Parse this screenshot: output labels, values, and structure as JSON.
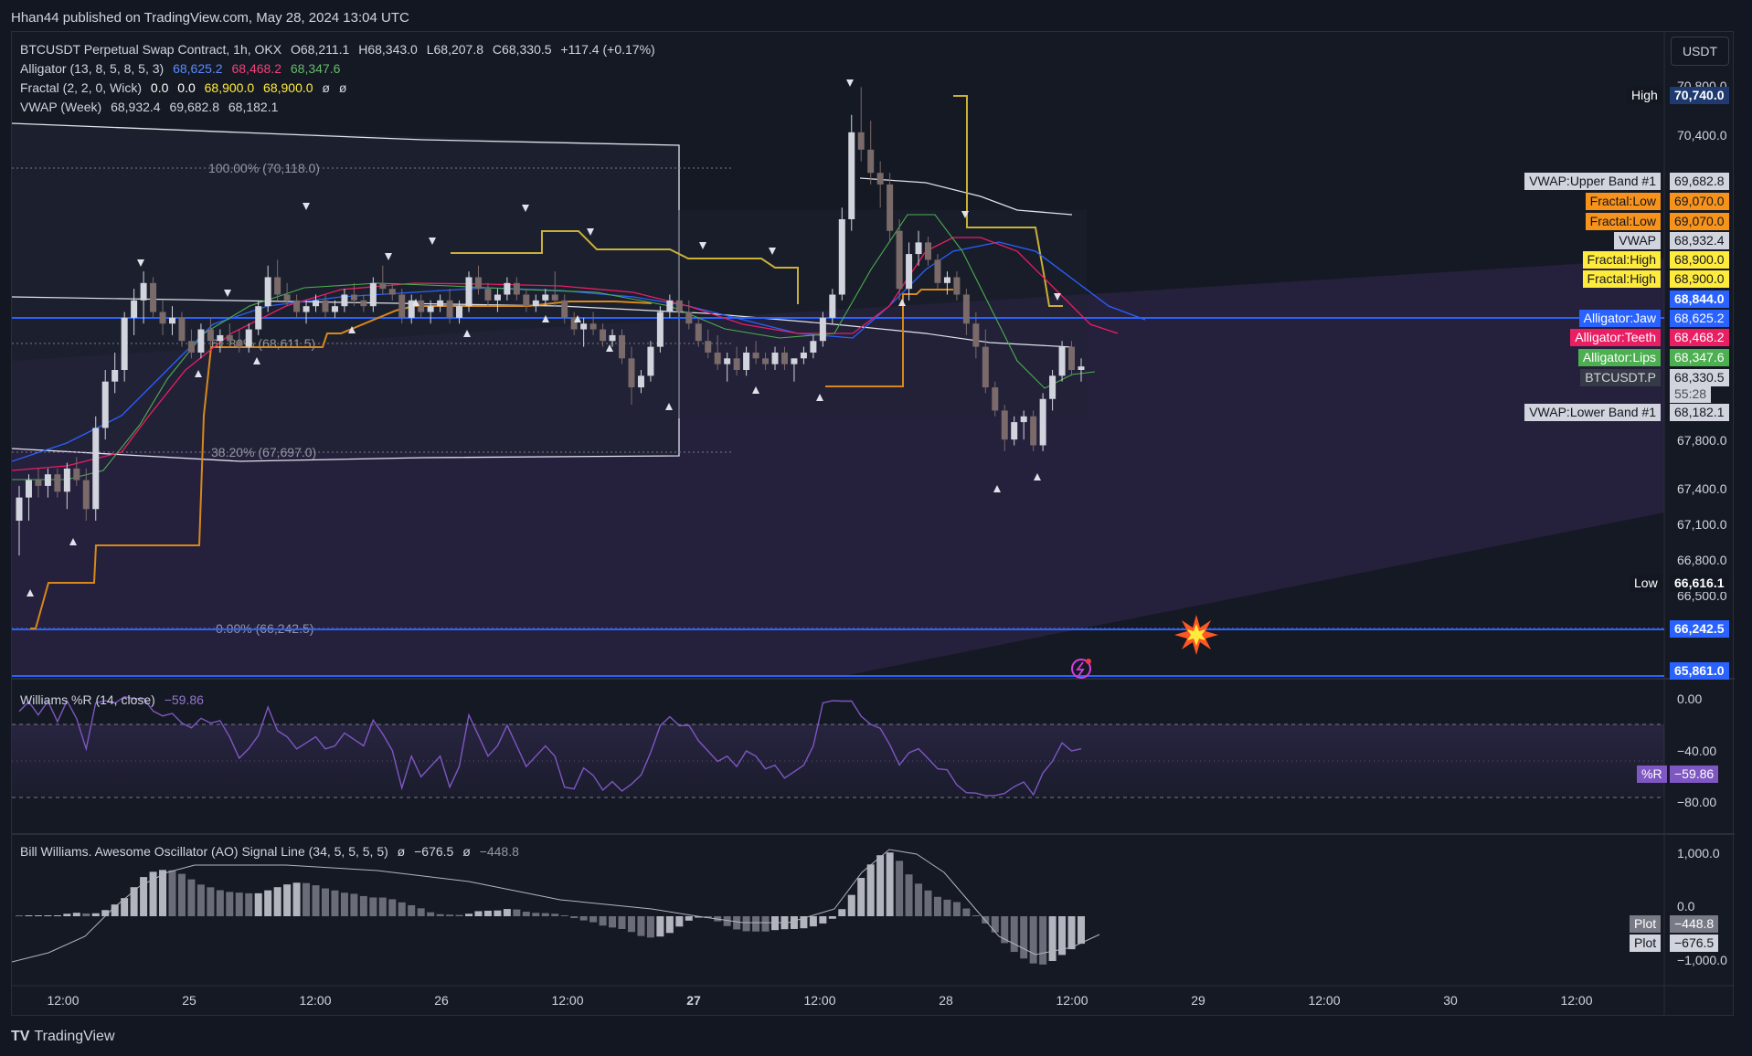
{
  "header": {
    "publisher": "Hhan44 published on TradingView.com, May 28, 2024 13:04 UTC"
  },
  "currency_button": "USDT",
  "footer": {
    "brand": "TradingView"
  },
  "legend": {
    "symbol": {
      "label": "BTCUSDT Perpetual Swap Contract, 1h, OKX",
      "o": "O68,211.1",
      "h": "H68,343.0",
      "l": "L68,207.8",
      "c": "C68,330.5",
      "chg": "+117.4 (+0.17%)"
    },
    "alligator": {
      "label": "Alligator (13, 8, 5, 8, 5, 3)",
      "jaw": "68,625.2",
      "teeth": "68,468.2",
      "lips": "68,347.6"
    },
    "fractal": {
      "label": "Fractal (2, 2, 0, Wick)",
      "v1": "0.0",
      "v2": "0.0",
      "v3": "68,900.0",
      "v4": "68,900.0",
      "v5": "ø",
      "v6": "ø"
    },
    "vwap": {
      "label": "VWAP (Week)",
      "v1": "68,932.4",
      "v2": "69,682.8",
      "v3": "68,182.1"
    },
    "williams": {
      "label": "Williams %R (14, close)",
      "value": "−59.86"
    },
    "ao": {
      "label": "Bill Williams. Awesome Oscillator (AO) Signal Line (34, 5, 5, 5, 5)",
      "v1": "ø",
      "v2": "−676.5",
      "v3": "ø",
      "v4": "−448.8"
    }
  },
  "price_axis": {
    "ticks": [
      "70,800.0",
      "70,400.0",
      "67,800.0",
      "67,400.0",
      "67,100.0",
      "66,800.0",
      "66,500.0"
    ],
    "high": {
      "label": "High",
      "value": "70,740.0"
    },
    "low": {
      "label": "Low",
      "value": "66,616.1"
    },
    "tags": [
      {
        "label": "VWAP:Upper Band #1",
        "value": "69,682.8",
        "color": "#e0e3eb"
      },
      {
        "label": "Fractal:Low",
        "value": "69,070.0",
        "color": "#f7931a"
      },
      {
        "label": "Fractal:Low",
        "value": "69,070.0",
        "color": "#f7931a"
      },
      {
        "label": "VWAP",
        "value": "68,932.4",
        "color": "#e0e3eb"
      },
      {
        "label": "Fractal:High",
        "value": "68,900.0",
        "color": "#ffeb3b"
      },
      {
        "label": "Fractal:High",
        "value": "68,900.0",
        "color": "#ffeb3b"
      },
      {
        "label": "",
        "value": "68,844.0",
        "color": "#2962ff"
      },
      {
        "label": "Alligator:Jaw",
        "value": "68,625.2",
        "color": "#2962ff"
      },
      {
        "label": "Alligator:Teeth",
        "value": "68,468.2",
        "color": "#e91e63"
      },
      {
        "label": "Alligator:Lips",
        "value": "68,347.6",
        "color": "#4caf50"
      },
      {
        "label": "BTCUSDT.P",
        "value": "68,330.5",
        "color": "#d1d4dc"
      },
      {
        "label": "VWAP:Lower Band #1",
        "value": "68,182.1",
        "color": "#e0e3eb"
      },
      {
        "label": "",
        "value": "66,242.5",
        "color": "#2962ff"
      },
      {
        "label": "",
        "value": "65,861.0",
        "color": "#2962ff"
      }
    ],
    "countdown": "55:28"
  },
  "fib_labels": [
    "100.00% (70,118.0)",
    "61.80% (68,611.5)",
    "38.20% (67,697.0)",
    "0.00% (66,242.5)"
  ],
  "wr_axis": {
    "ticks": [
      "0.00",
      "−40.00",
      "−80.00"
    ],
    "tag_label": "%R",
    "tag_value": "−59.86"
  },
  "ao_axis": {
    "ticks": [
      "1,000.0",
      "0.0",
      "−1,000.0"
    ],
    "plot1": {
      "label": "Plot",
      "value": "−448.8"
    },
    "plot2": {
      "label": "Plot",
      "value": "−676.5"
    }
  },
  "time_axis": [
    "12:00",
    "25",
    "12:00",
    "26",
    "12:00",
    "27",
    "12:00",
    "28",
    "12:00",
    "29",
    "12:00",
    "30",
    "12:00"
  ],
  "chart_data": {
    "type": "candlestick",
    "symbol": "BTCUSDT.P",
    "timeframe": "1h",
    "price_range": [
      65700,
      70900
    ],
    "candles": [
      [
        67000,
        67300,
        66700,
        67200
      ],
      [
        67200,
        67400,
        67000,
        67350
      ],
      [
        67350,
        67450,
        67200,
        67300
      ],
      [
        67300,
        67450,
        67200,
        67400
      ],
      [
        67400,
        67450,
        67200,
        67250
      ],
      [
        67250,
        67500,
        67100,
        67450
      ],
      [
        67450,
        67550,
        67300,
        67350
      ],
      [
        67350,
        67450,
        67000,
        67100
      ],
      [
        67100,
        67900,
        67000,
        67800
      ],
      [
        67800,
        68300,
        67700,
        68200
      ],
      [
        68200,
        68450,
        68100,
        68300
      ],
      [
        68300,
        68800,
        68200,
        68750
      ],
      [
        68750,
        69000,
        68600,
        68900
      ],
      [
        68900,
        69150,
        68700,
        69050
      ],
      [
        69050,
        69100,
        68750,
        68800
      ],
      [
        68800,
        68900,
        68600,
        68700
      ],
      [
        68700,
        68850,
        68600,
        68750
      ],
      [
        68750,
        68800,
        68500,
        68550
      ],
      [
        68550,
        68650,
        68400,
        68450
      ],
      [
        68450,
        68700,
        68400,
        68650
      ],
      [
        68650,
        68750,
        68500,
        68550
      ],
      [
        68550,
        68650,
        68450,
        68600
      ],
      [
        68600,
        68700,
        68500,
        68550
      ],
      [
        68550,
        68650,
        68450,
        68500
      ],
      [
        68500,
        68700,
        68450,
        68650
      ],
      [
        68650,
        68900,
        68600,
        68850
      ],
      [
        68850,
        69200,
        68800,
        69100
      ],
      [
        69100,
        69250,
        68900,
        68950
      ],
      [
        68950,
        69050,
        68850,
        68900
      ],
      [
        68900,
        68950,
        68750,
        68800
      ],
      [
        68800,
        68900,
        68700,
        68850
      ],
      [
        68850,
        68950,
        68800,
        68900
      ],
      [
        68900,
        68950,
        68750,
        68800
      ],
      [
        68800,
        68900,
        68750,
        68850
      ],
      [
        68850,
        69000,
        68800,
        68950
      ],
      [
        68950,
        69050,
        68850,
        68900
      ],
      [
        68900,
        68950,
        68800,
        68850
      ],
      [
        68850,
        69100,
        68800,
        69050
      ],
      [
        69050,
        69200,
        68950,
        69000
      ],
      [
        69000,
        69050,
        68900,
        68950
      ],
      [
        68950,
        69000,
        68700,
        68750
      ],
      [
        68750,
        68950,
        68700,
        68900
      ],
      [
        68900,
        68950,
        68750,
        68800
      ],
      [
        68800,
        68900,
        68700,
        68850
      ],
      [
        68850,
        68950,
        68800,
        68900
      ],
      [
        68900,
        69000,
        68700,
        68750
      ],
      [
        68750,
        68900,
        68700,
        68850
      ],
      [
        68850,
        69150,
        68800,
        69100
      ],
      [
        69100,
        69200,
        68950,
        69000
      ],
      [
        69000,
        69050,
        68850,
        68900
      ],
      [
        68900,
        69000,
        68800,
        68950
      ],
      [
        68950,
        69100,
        68900,
        69050
      ],
      [
        69050,
        69100,
        68900,
        68950
      ],
      [
        68950,
        69000,
        68800,
        68850
      ],
      [
        68850,
        68950,
        68800,
        68900
      ],
      [
        68900,
        69000,
        68850,
        68950
      ],
      [
        68950,
        69150,
        68850,
        68900
      ],
      [
        68900,
        68950,
        68700,
        68750
      ],
      [
        68750,
        68800,
        68600,
        68650
      ],
      [
        68650,
        68750,
        68500,
        68700
      ],
      [
        68700,
        68800,
        68600,
        68650
      ],
      [
        68650,
        68700,
        68500,
        68550
      ],
      [
        68550,
        68650,
        68500,
        68600
      ],
      [
        68600,
        68650,
        68350,
        68400
      ],
      [
        68400,
        68500,
        68000,
        68150
      ],
      [
        68150,
        68300,
        68100,
        68250
      ],
      [
        68250,
        68550,
        68200,
        68500
      ],
      [
        68500,
        68850,
        68450,
        68800
      ],
      [
        68800,
        68950,
        68750,
        68900
      ],
      [
        68900,
        69000,
        68750,
        68800
      ],
      [
        68800,
        68900,
        68650,
        68700
      ],
      [
        68700,
        68750,
        68500,
        68550
      ],
      [
        68550,
        68650,
        68400,
        68450
      ],
      [
        68450,
        68600,
        68300,
        68350
      ],
      [
        68350,
        68450,
        68200,
        68400
      ],
      [
        68400,
        68500,
        68250,
        68300
      ],
      [
        68300,
        68500,
        68250,
        68450
      ],
      [
        68450,
        68550,
        68350,
        68400
      ],
      [
        68400,
        68450,
        68300,
        68350
      ],
      [
        68350,
        68500,
        68300,
        68450
      ],
      [
        68450,
        68500,
        68300,
        68350
      ],
      [
        68350,
        68400,
        68200,
        68400
      ],
      [
        68400,
        68500,
        68350,
        68450
      ],
      [
        68450,
        68600,
        68400,
        68550
      ],
      [
        68550,
        68800,
        68500,
        68750
      ],
      [
        68750,
        69000,
        68700,
        68950
      ],
      [
        68950,
        69700,
        68900,
        69600
      ],
      [
        69600,
        70500,
        69500,
        70350
      ],
      [
        70350,
        70740,
        70100,
        70200
      ],
      [
        70200,
        70450,
        69900,
        70000
      ],
      [
        70000,
        70100,
        69700,
        69900
      ],
      [
        69900,
        70000,
        69400,
        69500
      ],
      [
        69500,
        69600,
        68900,
        69000
      ],
      [
        69000,
        69400,
        68900,
        69300
      ],
      [
        69300,
        69500,
        69200,
        69400
      ],
      [
        69400,
        69450,
        69200,
        69250
      ],
      [
        69250,
        69300,
        69000,
        69050
      ],
      [
        69050,
        69150,
        68950,
        69100
      ],
      [
        69100,
        69150,
        68900,
        68950
      ],
      [
        68950,
        69000,
        68600,
        68700
      ],
      [
        68700,
        68800,
        68400,
        68500
      ],
      [
        68500,
        68650,
        68100,
        68150
      ],
      [
        68150,
        68200,
        67900,
        67950
      ],
      [
        67950,
        68000,
        67600,
        67700
      ],
      [
        67700,
        67900,
        67650,
        67850
      ],
      [
        67850,
        67950,
        67700,
        67900
      ],
      [
        67900,
        67950,
        67600,
        67650
      ],
      [
        67650,
        68100,
        67600,
        68050
      ],
      [
        68050,
        68300,
        67950,
        68250
      ],
      [
        68250,
        68550,
        68200,
        68500
      ],
      [
        68500,
        68550,
        68250,
        68300
      ],
      [
        68300,
        68400,
        68200,
        68330.5
      ]
    ]
  }
}
